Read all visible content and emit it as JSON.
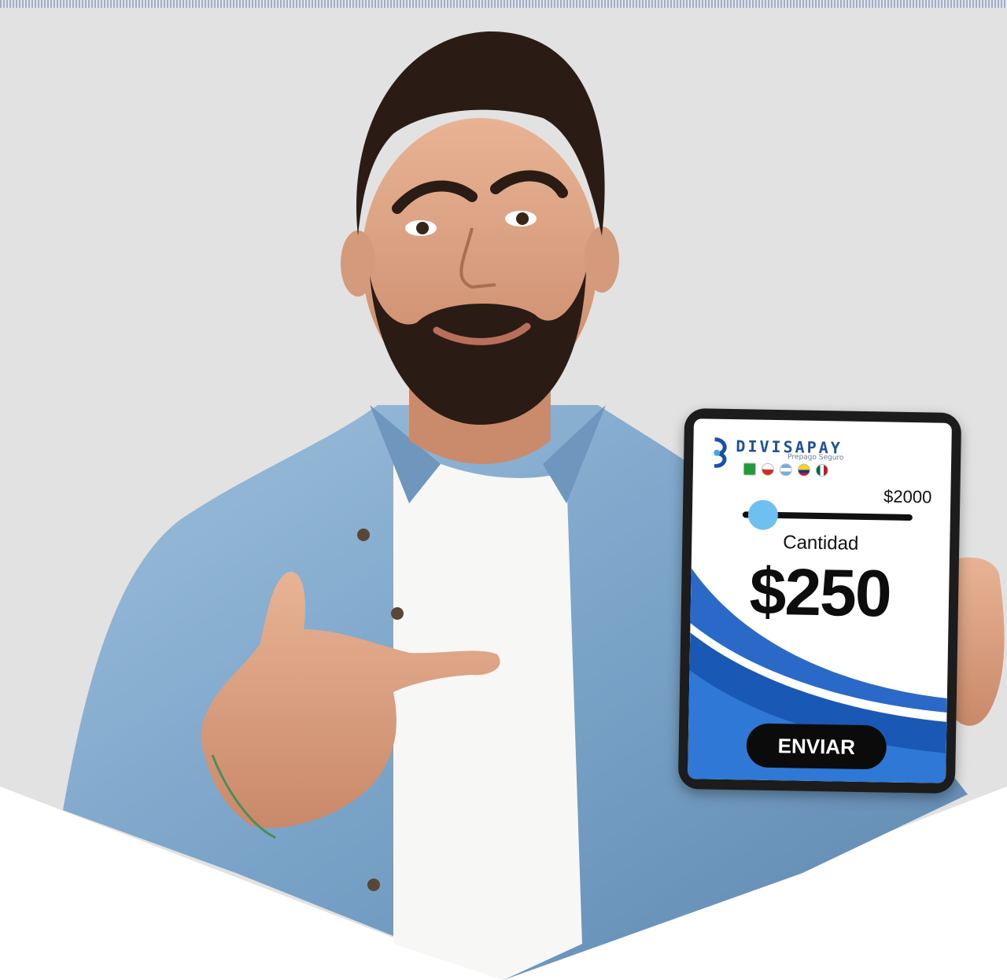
{
  "colors": {
    "background": "#e2e2e2",
    "shirt": "#7ea7cc",
    "brand": "#1d4fa3",
    "wave": "#2a69c7",
    "thumb": "#6ec0f0"
  },
  "tablet": {
    "brand_name": "DIVISAPAY",
    "brand_tagline": "Prepago Seguro",
    "flags": [
      "brazil",
      "chile",
      "argentina",
      "colombia",
      "mexico"
    ],
    "slider": {
      "max_label": "$2000",
      "value_fraction": 0.12
    },
    "amount_caption": "Cantidad",
    "amount_value": "$250",
    "send_label": "ENVIAR"
  }
}
